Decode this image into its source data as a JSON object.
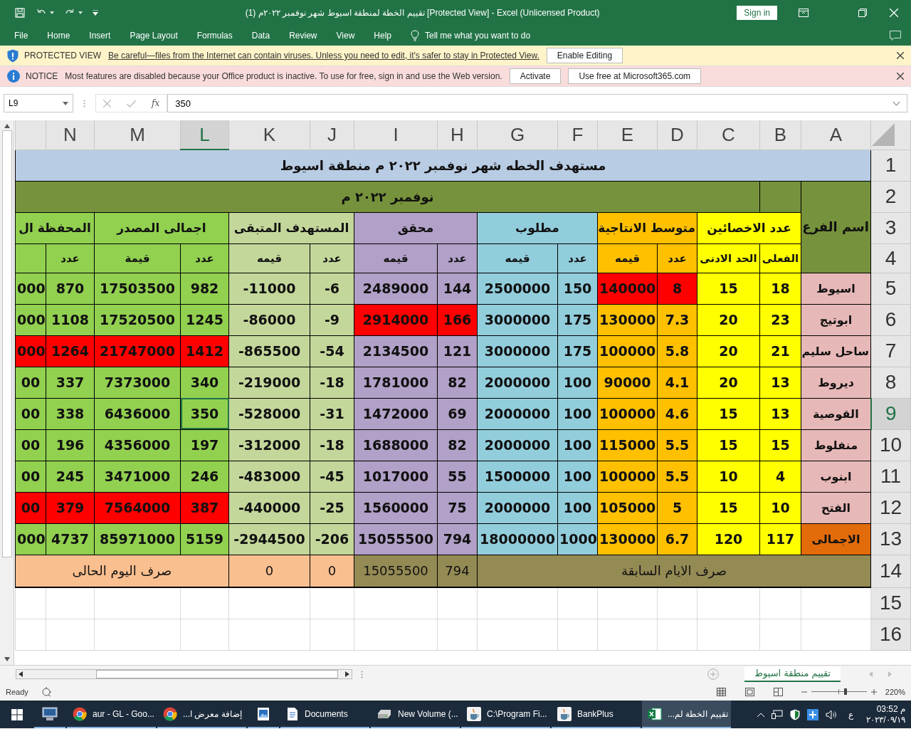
{
  "title_bar": {
    "title": "تقييم الخطة لمنطقة اسيوط شهر  نوفمبر ٢٠٢٢م (1)  [Protected View]  -  Excel (Unlicensed Product)",
    "sign_in": "Sign in"
  },
  "menu": {
    "items": [
      "File",
      "Home",
      "Insert",
      "Page Layout",
      "Formulas",
      "Data",
      "Review",
      "View",
      "Help"
    ],
    "tell_me": "Tell me what you want to do"
  },
  "message_bars": [
    {
      "kind": "warning",
      "label": "PROTECTED VIEW",
      "message": "Be careful—files from the Internet can contain viruses. Unless you need to edit, it's safer to stay in Protected View.",
      "buttons": [
        "Enable Editing"
      ]
    },
    {
      "kind": "notice",
      "label": "NOTICE",
      "message": "Most features are disabled because your Office product is inactive. To use for free, sign in and use the Web version.",
      "buttons": [
        "Activate",
        "Use free at Microsoft365.com"
      ]
    }
  ],
  "formula_bar": {
    "name_box": "L9",
    "function_label": "fx",
    "value": "350"
  },
  "sheet": {
    "columns": [
      {
        "label": "N",
        "selected": false
      },
      {
        "label": "M",
        "selected": false
      },
      {
        "label": "L",
        "selected": true
      },
      {
        "label": "K",
        "selected": false
      },
      {
        "label": "J",
        "selected": false
      },
      {
        "label": "I",
        "selected": false
      },
      {
        "label": "H",
        "selected": false
      },
      {
        "label": "G",
        "selected": false
      },
      {
        "label": "F",
        "selected": false
      },
      {
        "label": "E",
        "selected": false
      },
      {
        "label": "D",
        "selected": false
      },
      {
        "label": "C",
        "selected": false
      },
      {
        "label": "B",
        "selected": false
      },
      {
        "label": "A",
        "selected": false
      }
    ],
    "rows": [
      {
        "label": "1",
        "selected": false,
        "kind": "title",
        "cells": [
          {
            "text": "مستهدف الخطه شهر نوفمبر ٢٠٢٢ م  منطقة اسيوط",
            "color": "#b8cce4"
          }
        ]
      },
      {
        "label": "2",
        "selected": false,
        "kind": "band",
        "cells": [
          {
            "text": "نوفمبر ٢٠٢٢ م",
            "color": "#76923c"
          },
          {
            "color": "#76923c"
          },
          {
            "text": "اسم الفرع",
            "color": "#76923c"
          }
        ]
      },
      {
        "label": "3",
        "selected": false,
        "kind": "group",
        "cells": [
          {
            "text": "عدد الاخصائين",
            "color": "#ffff00"
          },
          {
            "text": "متوسط الانتاجية",
            "color": "#ffc000"
          },
          {
            "text": "مطلوب",
            "color": "#92cddc"
          },
          {
            "text": "محقق",
            "color": "#b1a0c7"
          },
          {
            "text": "المستهدف المتبقى",
            "color": "#c4d79b"
          },
          {
            "text": "اجمالى المصدر",
            "color": "#92d050"
          },
          {
            "text": "المحفظة ال",
            "color": "#92d050"
          }
        ]
      },
      {
        "label": "4",
        "selected": false,
        "kind": "subheading",
        "cells": [
          {
            "text": "الفعلى",
            "color": "#ffff00"
          },
          {
            "text": "الحد الادنى",
            "color": "#ffff00"
          },
          {
            "text": "عدد",
            "color": "#ffc000"
          },
          {
            "text": "قيمه",
            "color": "#ffc000"
          },
          {
            "text": "عدد",
            "color": "#92cddc"
          },
          {
            "text": "قيمه",
            "color": "#92cddc"
          },
          {
            "text": "عدد",
            "color": "#b1a0c7"
          },
          {
            "text": "قيمه",
            "color": "#b1a0c7"
          },
          {
            "text": "عدد",
            "color": "#c4d79b"
          },
          {
            "text": "قيمه",
            "color": "#c4d79b"
          },
          {
            "text": "عدد",
            "color": "#92d050"
          },
          {
            "text": "قيمة",
            "color": "#92d050"
          },
          {
            "text": "عدد",
            "color": "#92d050"
          },
          {
            "color": "#92d050"
          }
        ]
      },
      {
        "label": "5",
        "selected": false,
        "kind": "data",
        "cells": [
          {
            "text": "000",
            "color": "#92d050"
          },
          {
            "text": "870",
            "color": "#92d050"
          },
          {
            "text": "17503500",
            "color": "#92d050"
          },
          {
            "text": "982",
            "color": "#92d050"
          },
          {
            "text": "-11000",
            "color": "#c4d79b"
          },
          {
            "text": "-6",
            "color": "#c4d79b"
          },
          {
            "text": "2489000",
            "color": "#b1a0c7"
          },
          {
            "text": "144",
            "color": "#b1a0c7"
          },
          {
            "text": "2500000",
            "color": "#92cddc"
          },
          {
            "text": "150",
            "color": "#92cddc"
          },
          {
            "text": "140000",
            "color": "#ff0000"
          },
          {
            "text": "8",
            "color": "#ff0000"
          },
          {
            "text": "15",
            "color": "#ffff00"
          },
          {
            "text": "18",
            "color": "#ffff00"
          },
          {
            "text": "اسيوط",
            "color": "#e6b8b7"
          }
        ]
      },
      {
        "label": "6",
        "selected": false,
        "kind": "data",
        "cells": [
          {
            "text": "000",
            "color": "#92d050"
          },
          {
            "text": "1108",
            "color": "#92d050"
          },
          {
            "text": "17520500",
            "color": "#92d050"
          },
          {
            "text": "1245",
            "color": "#92d050"
          },
          {
            "text": "-86000",
            "color": "#c4d79b"
          },
          {
            "text": "-9",
            "color": "#c4d79b"
          },
          {
            "text": "2914000",
            "color": "#ff0000"
          },
          {
            "text": "166",
            "color": "#ff0000"
          },
          {
            "text": "3000000",
            "color": "#92cddc"
          },
          {
            "text": "175",
            "color": "#92cddc"
          },
          {
            "text": "130000",
            "color": "#ffc000"
          },
          {
            "text": "7.3",
            "color": "#ffc000"
          },
          {
            "text": "20",
            "color": "#ffff00"
          },
          {
            "text": "23",
            "color": "#ffff00"
          },
          {
            "text": "ابوتيج",
            "color": "#e6b8b7"
          }
        ]
      },
      {
        "label": "7",
        "selected": false,
        "kind": "data",
        "cells": [
          {
            "text": "000",
            "color": "#ff0000"
          },
          {
            "text": "1264",
            "color": "#ff0000"
          },
          {
            "text": "21747000",
            "color": "#ff0000"
          },
          {
            "text": "1412",
            "color": "#ff0000"
          },
          {
            "text": "-865500",
            "color": "#c4d79b"
          },
          {
            "text": "-54",
            "color": "#c4d79b"
          },
          {
            "text": "2134500",
            "color": "#b1a0c7"
          },
          {
            "text": "121",
            "color": "#b1a0c7"
          },
          {
            "text": "3000000",
            "color": "#92cddc"
          },
          {
            "text": "175",
            "color": "#92cddc"
          },
          {
            "text": "100000",
            "color": "#ffc000"
          },
          {
            "text": "5.8",
            "color": "#ffc000"
          },
          {
            "text": "20",
            "color": "#ffff00"
          },
          {
            "text": "21",
            "color": "#ffff00"
          },
          {
            "text": "ساحل سليم",
            "color": "#e6b8b7"
          }
        ]
      },
      {
        "label": "8",
        "selected": false,
        "kind": "data",
        "cells": [
          {
            "text": "00",
            "color": "#92d050"
          },
          {
            "text": "337",
            "color": "#92d050"
          },
          {
            "text": "7373000",
            "color": "#92d050"
          },
          {
            "text": "340",
            "color": "#92d050"
          },
          {
            "text": "-219000",
            "color": "#c4d79b"
          },
          {
            "text": "-18",
            "color": "#c4d79b"
          },
          {
            "text": "1781000",
            "color": "#b1a0c7"
          },
          {
            "text": "82",
            "color": "#b1a0c7"
          },
          {
            "text": "2000000",
            "color": "#92cddc"
          },
          {
            "text": "100",
            "color": "#92cddc"
          },
          {
            "text": "90000",
            "color": "#ffc000"
          },
          {
            "text": "4.1",
            "color": "#ffc000"
          },
          {
            "text": "20",
            "color": "#ffff00"
          },
          {
            "text": "13",
            "color": "#ffff00"
          },
          {
            "text": "ديروط",
            "color": "#e6b8b7"
          }
        ]
      },
      {
        "label": "9",
        "selected": true,
        "kind": "data",
        "cells": [
          {
            "text": "00",
            "color": "#92d050"
          },
          {
            "text": "338",
            "color": "#92d050"
          },
          {
            "text": "6436000",
            "color": "#92d050"
          },
          {
            "text": "350",
            "color": "#92d050"
          },
          {
            "text": "-528000",
            "color": "#c4d79b"
          },
          {
            "text": "-31",
            "color": "#c4d79b"
          },
          {
            "text": "1472000",
            "color": "#b1a0c7"
          },
          {
            "text": "69",
            "color": "#b1a0c7"
          },
          {
            "text": "2000000",
            "color": "#92cddc"
          },
          {
            "text": "100",
            "color": "#92cddc"
          },
          {
            "text": "100000",
            "color": "#ffc000"
          },
          {
            "text": "4.6",
            "color": "#ffc000"
          },
          {
            "text": "15",
            "color": "#ffff00"
          },
          {
            "text": "13",
            "color": "#ffff00"
          },
          {
            "text": "القوصية",
            "color": "#e6b8b7"
          }
        ]
      },
      {
        "label": "10",
        "selected": false,
        "kind": "data",
        "cells": [
          {
            "text": "00",
            "color": "#92d050"
          },
          {
            "text": "196",
            "color": "#92d050"
          },
          {
            "text": "4356000",
            "color": "#92d050"
          },
          {
            "text": "197",
            "color": "#92d050"
          },
          {
            "text": "-312000",
            "color": "#c4d79b"
          },
          {
            "text": "-18",
            "color": "#c4d79b"
          },
          {
            "text": "1688000",
            "color": "#b1a0c7"
          },
          {
            "text": "82",
            "color": "#b1a0c7"
          },
          {
            "text": "2000000",
            "color": "#92cddc"
          },
          {
            "text": "100",
            "color": "#92cddc"
          },
          {
            "text": "115000",
            "color": "#ffc000"
          },
          {
            "text": "5.5",
            "color": "#ffc000"
          },
          {
            "text": "15",
            "color": "#ffff00"
          },
          {
            "text": "15",
            "color": "#ffff00"
          },
          {
            "text": "منفلوط",
            "color": "#e6b8b7"
          }
        ]
      },
      {
        "label": "11",
        "selected": false,
        "kind": "data",
        "cells": [
          {
            "text": "00",
            "color": "#92d050"
          },
          {
            "text": "245",
            "color": "#92d050"
          },
          {
            "text": "3471000",
            "color": "#92d050"
          },
          {
            "text": "246",
            "color": "#92d050"
          },
          {
            "text": "-483000",
            "color": "#c4d79b"
          },
          {
            "text": "-45",
            "color": "#c4d79b"
          },
          {
            "text": "1017000",
            "color": "#b1a0c7"
          },
          {
            "text": "55",
            "color": "#b1a0c7"
          },
          {
            "text": "1500000",
            "color": "#92cddc"
          },
          {
            "text": "100",
            "color": "#92cddc"
          },
          {
            "text": "100000",
            "color": "#ffc000"
          },
          {
            "text": "5.5",
            "color": "#ffc000"
          },
          {
            "text": "10",
            "color": "#ffff00"
          },
          {
            "text": "4",
            "color": "#ffff00"
          },
          {
            "text": "ابنوب",
            "color": "#e6b8b7"
          }
        ]
      },
      {
        "label": "12",
        "selected": false,
        "kind": "data",
        "cells": [
          {
            "text": "00",
            "color": "#ff0000"
          },
          {
            "text": "379",
            "color": "#ff0000"
          },
          {
            "text": "7564000",
            "color": "#ff0000"
          },
          {
            "text": "387",
            "color": "#ff0000"
          },
          {
            "text": "-440000",
            "color": "#c4d79b"
          },
          {
            "text": "-25",
            "color": "#c4d79b"
          },
          {
            "text": "1560000",
            "color": "#b1a0c7"
          },
          {
            "text": "75",
            "color": "#b1a0c7"
          },
          {
            "text": "2000000",
            "color": "#92cddc"
          },
          {
            "text": "100",
            "color": "#92cddc"
          },
          {
            "text": "105000",
            "color": "#ffc000"
          },
          {
            "text": "5",
            "color": "#ffc000"
          },
          {
            "text": "15",
            "color": "#ffff00"
          },
          {
            "text": "10",
            "color": "#ffff00"
          },
          {
            "text": "الفتح",
            "color": "#e6b8b7"
          }
        ]
      },
      {
        "label": "13",
        "selected": false,
        "kind": "data",
        "cells": [
          {
            "text": "000",
            "color": "#92d050"
          },
          {
            "text": "4737",
            "color": "#92d050"
          },
          {
            "text": "85971000",
            "color": "#92d050"
          },
          {
            "text": "5159",
            "color": "#92d050"
          },
          {
            "text": "-2944500",
            "color": "#c4d79b"
          },
          {
            "text": "-206",
            "color": "#c4d79b"
          },
          {
            "text": "15055500",
            "color": "#b1a0c7"
          },
          {
            "text": "794",
            "color": "#b1a0c7"
          },
          {
            "text": "18000000",
            "color": "#92cddc"
          },
          {
            "text": "1000",
            "color": "#92cddc"
          },
          {
            "text": "130000",
            "color": "#ffc000"
          },
          {
            "text": "6.7",
            "color": "#ffc000"
          },
          {
            "text": "120",
            "color": "#ffff00"
          },
          {
            "text": "117",
            "color": "#ffff00"
          },
          {
            "text": "الاجمالى",
            "color": "#e26b0a"
          }
        ]
      },
      {
        "label": "14",
        "selected": false,
        "kind": "summary",
        "cells": [
          {
            "text": "صرف اليوم الحالى",
            "color": "#fabf8f"
          },
          {
            "text": "0",
            "color": "#fabf8f"
          },
          {
            "text": "0",
            "color": "#fabf8f"
          },
          {
            "text": "15055500",
            "color": "#948a54"
          },
          {
            "text": "794",
            "color": "#948a54"
          },
          {
            "text": "صرف الايام  السابقة",
            "color": "#948a54"
          }
        ]
      },
      {
        "label": "15",
        "selected": false,
        "kind": "empty"
      },
      {
        "label": "16",
        "selected": false,
        "kind": "empty"
      }
    ]
  },
  "sheet_tabs": [
    {
      "label": "تقييم منطقة اسيوط",
      "selected": true
    }
  ],
  "status_bar": {
    "status": "Ready",
    "zoom_slider": {
      "level": 0.62
    },
    "zoom": "220%"
  },
  "taskbar": {
    "items": [
      {
        "kind": "monitor",
        "active": false
      },
      {
        "kind": "chrome",
        "label": "aur - GL - Goo...",
        "active": false
      },
      {
        "kind": "chrome",
        "label": "إضافة معرض ا...",
        "active": false
      },
      {
        "kind": "photos",
        "active": false
      },
      {
        "kind": "documents",
        "label": "Documents",
        "active": false
      },
      {
        "kind": "drive",
        "label": "New Volume (...",
        "active": false
      },
      {
        "kind": "java",
        "label": "C:\\Program Fi...",
        "active": false
      },
      {
        "kind": "java",
        "label": "BankPlus",
        "active": false
      },
      {
        "kind": "excel",
        "label": "تقييم الخطة لم...",
        "active": true
      }
    ],
    "language": "ع",
    "time": "03:52 م",
    "date": "٢٠٢٣/٠٩/١٩"
  }
}
